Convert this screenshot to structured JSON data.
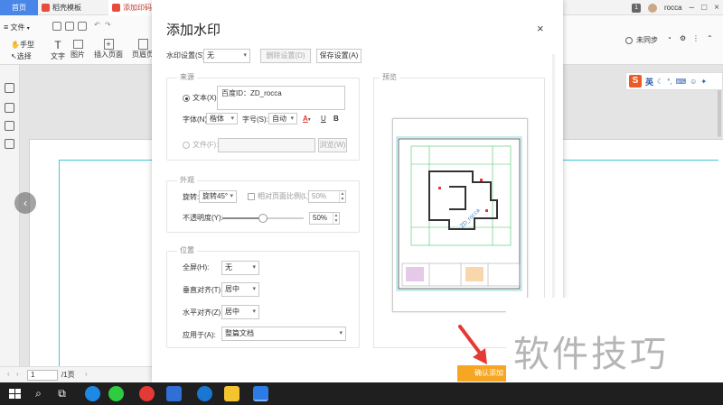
{
  "tabs": {
    "home": "首页",
    "templates": "稻壳模板",
    "doc": "添加印码.pdf"
  },
  "titlebar": {
    "tab_count": "1",
    "user": "rocca",
    "sync": "未同步"
  },
  "ribbon": {
    "file": "文件",
    "hand": "手型",
    "select": "选择",
    "text": "文字",
    "image": "图片",
    "insert_page": "插入页面",
    "header_footer": "页眉页"
  },
  "ime": {
    "logo": "S",
    "lang": "英"
  },
  "doc": {
    "page_current": "1",
    "page_total": "/1页"
  },
  "dialog": {
    "title": "添加水印",
    "watermark_setting_label": "水印设置(S):",
    "watermark_setting_value": "无",
    "delete_setting": "删除设置(D)",
    "save_setting": "保存设置(A)",
    "source_title": "来源",
    "text_label": "文本(X):",
    "text_value": "百度ID：ZD_rocca",
    "font_label": "字体(N):",
    "font_value": "楷体",
    "size_label": "字号(S):",
    "size_value": "自动",
    "underline": "U",
    "bold": "B",
    "color_glyph": "A",
    "file_label": "文件(F):",
    "browse": "浏览(W)",
    "appearance_title": "外观",
    "rotate_label": "旋转:",
    "rotate_value": "旋转45°",
    "relative_scale_label": "相对页面比例(L):",
    "relative_scale_value": "50%",
    "opacity_label": "不透明度(Y):",
    "opacity_value": "50%",
    "opacity_fraction": 0.5,
    "position_title": "位置",
    "fullscreen_label": "全屏(H):",
    "fullscreen_value": "无",
    "valign_label": "垂直对齐(T):",
    "valign_value": "居中",
    "halign_label": "水平对齐(Z):",
    "halign_value": "居中",
    "apply_label": "应用于(A):",
    "apply_value": "整篇文档",
    "preview_title": "预览",
    "confirm": "确认添加",
    "close": "×"
  },
  "brand_watermark": "软件技巧",
  "colors": {
    "accent": "#4a86e8",
    "confirm": "#f6a623",
    "guide": "#3ec7d8",
    "arrow": "#e53935"
  }
}
